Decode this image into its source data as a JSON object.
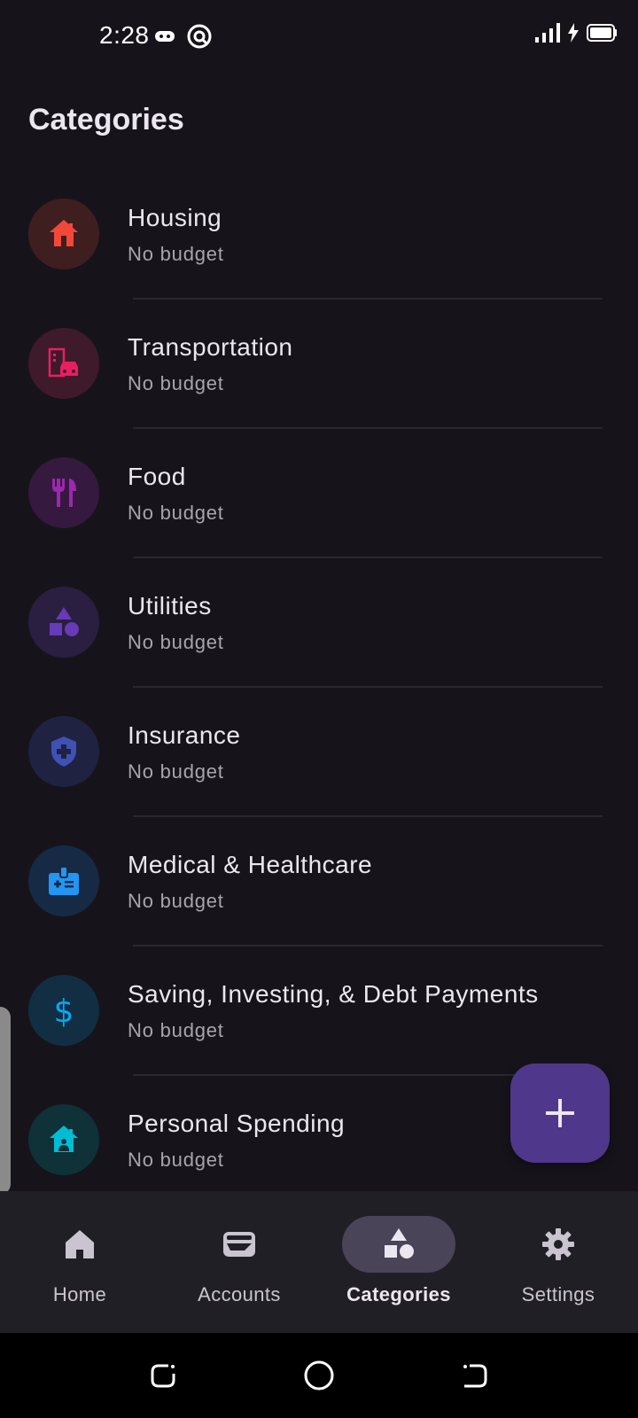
{
  "status_bar": {
    "time": "2:28",
    "left_icons": [
      "gamepad-icon",
      "assistant-icon"
    ],
    "right_icons": [
      "signal-icon",
      "charging-icon",
      "battery-icon"
    ]
  },
  "page": {
    "title": "Categories"
  },
  "categories": [
    {
      "name": "Housing",
      "budget": "No budget",
      "icon": "house-icon",
      "color": "#f2483a",
      "bg": "#3f1e20"
    },
    {
      "name": "Transportation",
      "budget": "No budget",
      "icon": "commute-icon",
      "color": "#e91e63",
      "bg": "#3f1a2b"
    },
    {
      "name": "Food",
      "budget": "No budget",
      "icon": "restaurant-icon",
      "color": "#9c27b0",
      "bg": "#35193f"
    },
    {
      "name": "Utilities",
      "budget": "No budget",
      "icon": "shapes-icon",
      "color": "#673ab7",
      "bg": "#2a1f40"
    },
    {
      "name": "Insurance",
      "budget": "No budget",
      "icon": "health-shield-icon",
      "color": "#3f51b5",
      "bg": "#1f2240"
    },
    {
      "name": "Medical & Healthcare",
      "budget": "No budget",
      "icon": "medical-id-icon",
      "color": "#2196f3",
      "bg": "#162a45"
    },
    {
      "name": "Saving, Investing, & Debt Payments",
      "budget": "No budget",
      "icon": "dollar-icon",
      "color": "#03a9f4",
      "bg": "#122e43"
    },
    {
      "name": "Personal Spending",
      "budget": "No budget",
      "icon": "home-person-icon",
      "color": "#00bcd4",
      "bg": "#0f3138"
    }
  ],
  "fab": {
    "icon": "plus-icon"
  },
  "bottom_nav": [
    {
      "label": "Home",
      "icon": "home-icon",
      "active": false
    },
    {
      "label": "Accounts",
      "icon": "wallet-icon",
      "active": false
    },
    {
      "label": "Categories",
      "icon": "category-shapes-icon",
      "active": true
    },
    {
      "label": "Settings",
      "icon": "gear-icon",
      "active": false
    }
  ],
  "system_nav": [
    "recents-icon",
    "home-circle-icon",
    "back-icon"
  ]
}
